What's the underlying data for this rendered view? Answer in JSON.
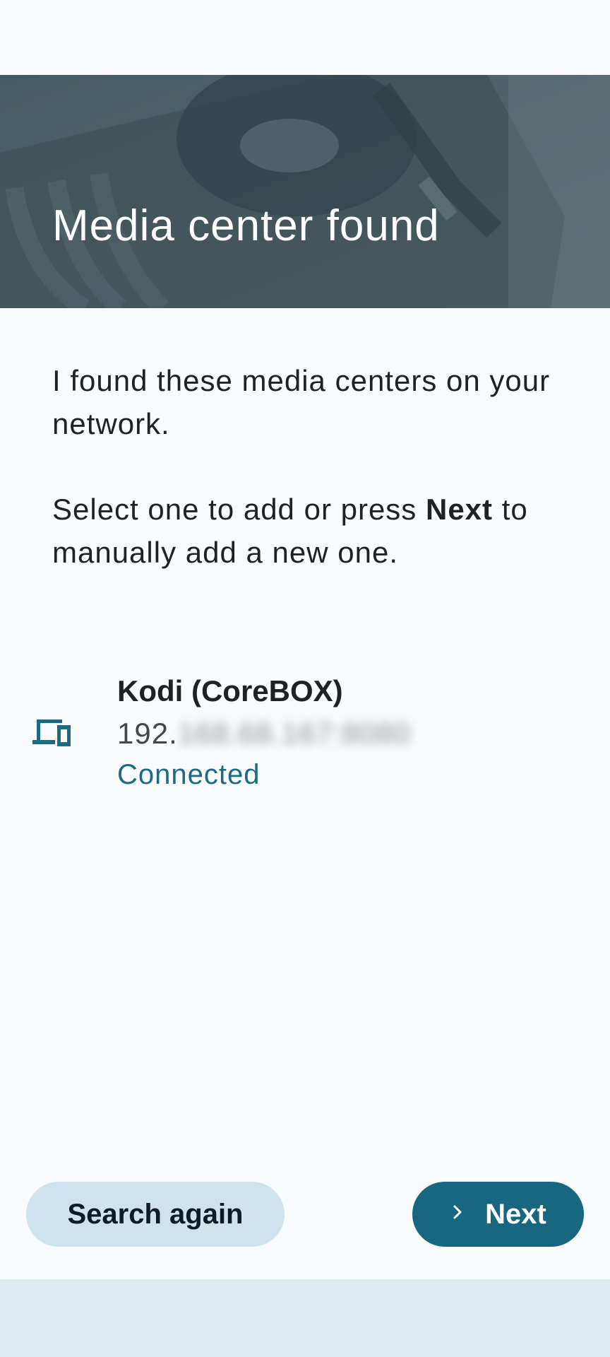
{
  "header": {
    "title": "Media center found"
  },
  "content": {
    "intro": "I found these media centers on your network.",
    "instruction_prefix": "Select one to add or press ",
    "instruction_bold": "Next",
    "instruction_suffix": " to manually add a new one."
  },
  "devices": [
    {
      "name": "Kodi (CoreBOX)",
      "address_visible": "192.",
      "address_hidden": "168.68.167:8080",
      "status": "Connected",
      "icon": "devices-icon"
    }
  ],
  "buttons": {
    "search_again": "Search again",
    "next": "Next"
  },
  "colors": {
    "accent": "#16677f",
    "status": "#1c6a83",
    "secondary_button": "#cfe3ef",
    "background": "#f9fbfd",
    "bottom_bar": "#dfebf1"
  }
}
